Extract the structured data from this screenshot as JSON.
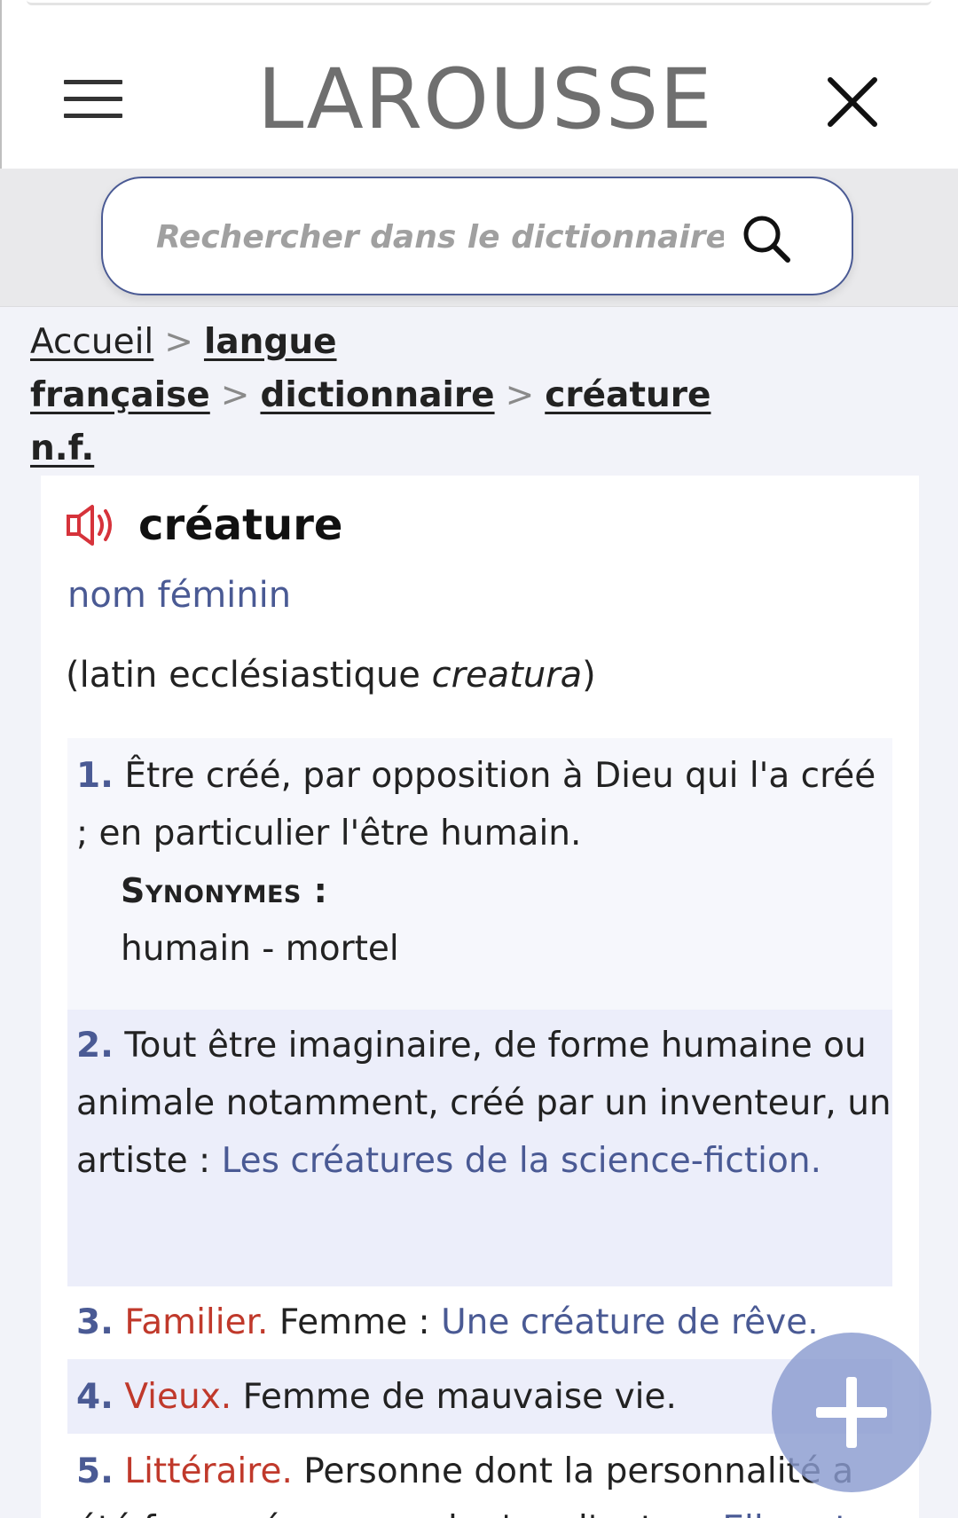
{
  "header": {
    "logo": "LAROUSSE"
  },
  "search": {
    "placeholder": "Rechercher dans le dictionnaire..."
  },
  "breadcrumb": {
    "items": [
      "Accueil",
      "langue française",
      "dictionnaire",
      "créature"
    ],
    "separator": ">",
    "tail": "n.f."
  },
  "entry": {
    "headword": "créature",
    "pos": "nom féminin",
    "etymology_prefix": "(latin ecclésiastique ",
    "etymology_word": "creatura",
    "etymology_suffix": ")",
    "definitions": [
      {
        "num": "1.",
        "text": "Être créé, par opposition à Dieu qui l'a créé ; en particulier l'être humain.",
        "synonyms_title": "Synonymes :",
        "synonyms": "humain - mortel"
      },
      {
        "num": "2.",
        "text": "Tout être imaginaire, de forme humaine ou animale notamment, créé par un inventeur, un artiste : ",
        "example": "Les créatures de la science-fiction."
      },
      {
        "num": "3.",
        "register": "Familier.",
        "text": "Femme : ",
        "example": "Une créature de rêve."
      },
      {
        "num": "4.",
        "register": "Vieux.",
        "text": "Femme de mauvaise vie."
      },
      {
        "num": "5.",
        "register": "Littéraire.",
        "text": "Personne dont la personnalité a été façonnée par quelqu'un d'autre : ",
        "example": "Elle est"
      }
    ]
  },
  "colors": {
    "accent": "#4a5a94",
    "register": "#c0392b",
    "fab": "#8a9bd0"
  }
}
